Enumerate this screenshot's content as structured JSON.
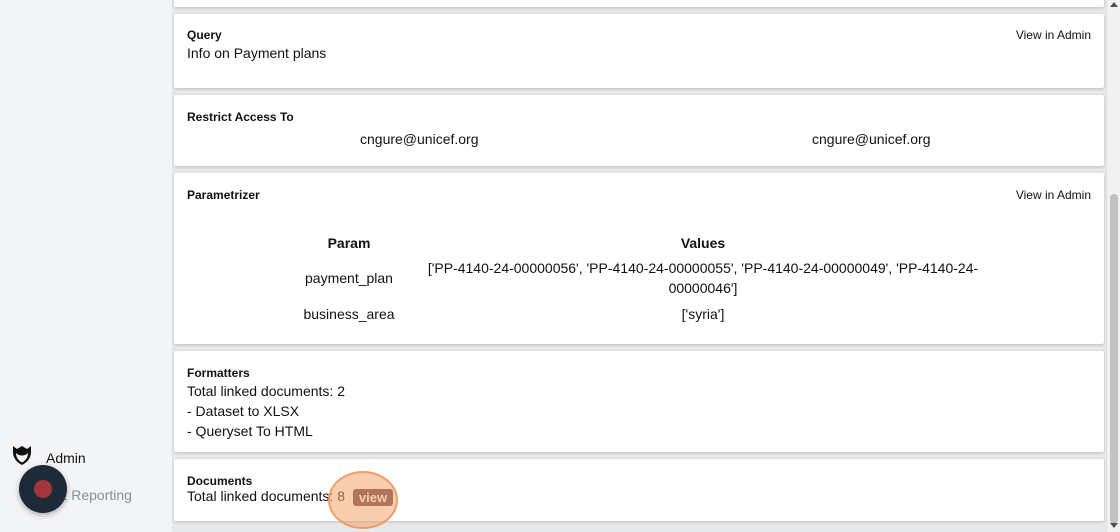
{
  "sidebar": {
    "items": [
      {
        "label": "Admin",
        "icon": "shield-icon"
      },
      {
        "label": "E Reporting",
        "icon": ""
      }
    ]
  },
  "cards": {
    "query": {
      "title": "Query",
      "link": "View in Admin",
      "text": "Info on Payment plans"
    },
    "restrict": {
      "title": "Restrict Access To",
      "emails": [
        "cngure@unicef.org",
        "cngure@unicef.org"
      ]
    },
    "parametrizer": {
      "title": "Parametrizer",
      "link": "View in Admin",
      "headers": {
        "param": "Param",
        "values": "Values"
      },
      "rows": [
        {
          "param": "payment_plan",
          "values": "['PP-4140-24-00000056', 'PP-4140-24-00000055', 'PP-4140-24-00000049', 'PP-4140-24-00000046']"
        },
        {
          "param": "business_area",
          "values": "['syria']"
        }
      ]
    },
    "formatters": {
      "title": "Formatters",
      "lines": [
        "Total linked documents: 2",
        "- Dataset to XLSX",
        "- Queryset To HTML"
      ]
    },
    "documents": {
      "title": "Documents",
      "text": "Total linked documents: 8",
      "view_label": "view"
    }
  },
  "colors": {
    "view_badge": "#5c3a4a",
    "record_button": "#1e2a38",
    "record_dot": "#a4353d",
    "highlight": "#f4a66e"
  }
}
